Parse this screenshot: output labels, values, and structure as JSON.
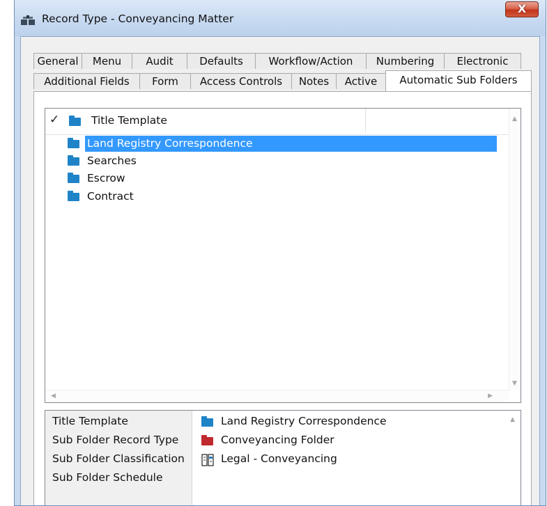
{
  "window": {
    "title": "Record Type - Conveyancing Matter",
    "close_label": "X"
  },
  "tabs_row1": [
    {
      "label": "General"
    },
    {
      "label": "Menu"
    },
    {
      "label": "Audit"
    },
    {
      "label": "Defaults"
    },
    {
      "label": "Workflow/Action"
    },
    {
      "label": "Numbering"
    },
    {
      "label": "Electronic"
    }
  ],
  "tabs_row2": [
    {
      "label": "Additional Fields"
    },
    {
      "label": "Form"
    },
    {
      "label": "Access Controls"
    },
    {
      "label": "Notes"
    },
    {
      "label": "Active"
    },
    {
      "label": "Automatic Sub Folders",
      "selected": true
    }
  ],
  "tree": {
    "header_check": "✓",
    "header_label": "Title Template",
    "items": [
      {
        "label": "Land Registry Correspondence",
        "selected": true
      },
      {
        "label": "Searches"
      },
      {
        "label": "Escrow"
      },
      {
        "label": "Contract"
      }
    ]
  },
  "details": {
    "labels": [
      "Title Template",
      "Sub Folder Record Type",
      "Sub Folder Classification",
      "Sub Folder Schedule"
    ],
    "values": [
      {
        "text": "Land Registry Correspondence",
        "icon": "blue-folder-icon"
      },
      {
        "text": "Conveyancing Folder",
        "icon": "red-folder-icon"
      },
      {
        "text": "Legal - Conveyancing",
        "icon": "classification-icon"
      }
    ]
  },
  "colors": {
    "selection": "#3399ff",
    "folder_blue": "#1f83c8",
    "folder_red": "#c0292e",
    "title_bar": "#c6d9f1"
  }
}
